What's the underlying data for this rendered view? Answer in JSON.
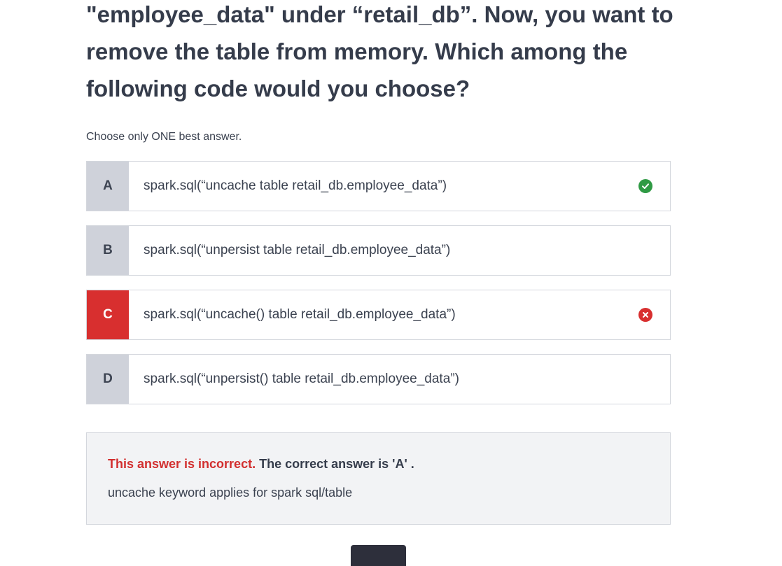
{
  "question": {
    "text": "\"employee_data\" under “retail_db”. Now, you want to remove the table from memory. Which among the following code would you choose?"
  },
  "instruction": "Choose only ONE best answer.",
  "options": [
    {
      "letter": "A",
      "text": "spark.sql(“uncache table retail_db.employee_data”)",
      "state": "correct",
      "icon": "check-circle-icon"
    },
    {
      "letter": "B",
      "text": "spark.sql(“unpersist table retail_db.employee_data”)",
      "state": "none"
    },
    {
      "letter": "C",
      "text": "spark.sql(“uncache() table retail_db.employee_data”)",
      "state": "selected-incorrect",
      "icon": "x-circle-icon"
    },
    {
      "letter": "D",
      "text": "spark.sql(“unpersist() table retail_db.employee_data”)",
      "state": "none"
    }
  ],
  "feedback": {
    "incorrect_label": "This answer is incorrect.",
    "correct_answer_text": "The correct answer is 'A' .",
    "explanation": "uncache keyword applies for spark sql/table"
  },
  "next_button": {
    "label": ""
  },
  "colors": {
    "incorrect": "#d82f2f",
    "correct": "#2f9a44",
    "letter_bg": "#cfd2da",
    "feedback_bg": "#f2f3f5"
  }
}
